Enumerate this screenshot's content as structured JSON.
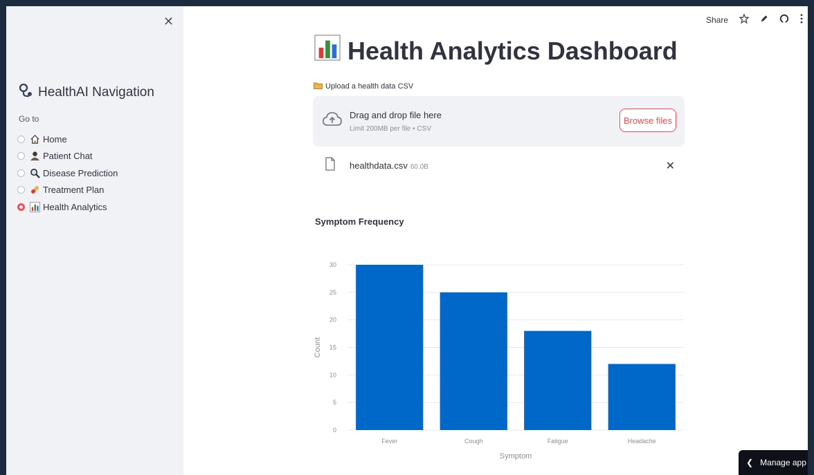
{
  "sidebar": {
    "title": "HealthAI Navigation",
    "goto_label": "Go to",
    "items": [
      {
        "label": "Home",
        "icon": "house-icon",
        "selected": false
      },
      {
        "label": "Patient Chat",
        "icon": "person-icon",
        "selected": false
      },
      {
        "label": "Disease Prediction",
        "icon": "magnifier-icon",
        "selected": false
      },
      {
        "label": "Treatment Plan",
        "icon": "pill-icon",
        "selected": false
      },
      {
        "label": "Health Analytics",
        "icon": "bar-chart-icon",
        "selected": true
      }
    ]
  },
  "toolbar": {
    "share_label": "Share"
  },
  "main": {
    "title": "Health Analytics Dashboard",
    "uploader": {
      "label": "Upload a health data CSV",
      "drag_text": "Drag and drop file here",
      "limit_text": "Limit 200MB per file • CSV",
      "browse_label": "Browse files"
    },
    "file": {
      "name": "healthdata.csv",
      "size": "60.0B"
    }
  },
  "chart_data": {
    "type": "bar",
    "title": "Symptom Frequency",
    "categories": [
      "Fever",
      "Cough",
      "Fatigue",
      "Headache"
    ],
    "values": [
      30,
      25,
      18,
      12
    ],
    "xlabel": "Symptom",
    "ylabel": "Count",
    "ylim": [
      0,
      30
    ],
    "yticks": [
      0,
      5,
      10,
      15,
      20,
      25,
      30
    ],
    "grid": true,
    "color": "#0068c9"
  },
  "footer": {
    "manage_label": "Manage app"
  },
  "colors": {
    "accent": "#ff4b4b",
    "bar": "#0068c9",
    "sidebar_bg": "#f0f2f6"
  }
}
